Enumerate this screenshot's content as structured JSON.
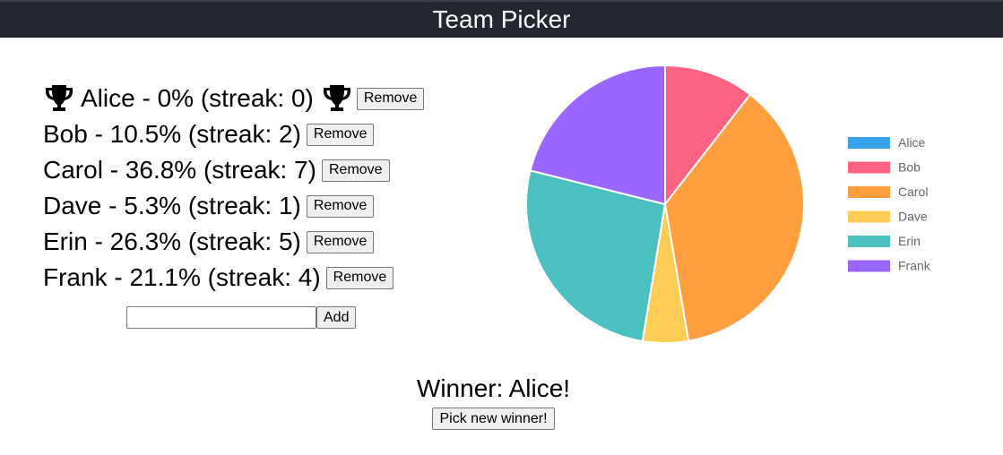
{
  "header": {
    "title": "Team Picker"
  },
  "players": [
    {
      "name": "Alice",
      "text": "Alice - 0% (streak: 0)",
      "percent": 0,
      "streak": 0,
      "winner": true,
      "remove_label": "Remove"
    },
    {
      "name": "Bob",
      "text": "Bob - 10.5% (streak: 2)",
      "percent": 10.5,
      "streak": 2,
      "winner": false,
      "remove_label": "Remove"
    },
    {
      "name": "Carol",
      "text": "Carol - 36.8% (streak: 7)",
      "percent": 36.8,
      "streak": 7,
      "winner": false,
      "remove_label": "Remove"
    },
    {
      "name": "Dave",
      "text": "Dave - 5.3% (streak: 1)",
      "percent": 5.3,
      "streak": 1,
      "winner": false,
      "remove_label": "Remove"
    },
    {
      "name": "Erin",
      "text": "Erin - 26.3% (streak: 5)",
      "percent": 26.3,
      "streak": 5,
      "winner": false,
      "remove_label": "Remove"
    },
    {
      "name": "Frank",
      "text": "Frank - 21.1% (streak: 4)",
      "percent": 21.1,
      "streak": 4,
      "winner": false,
      "remove_label": "Remove"
    }
  ],
  "add_form": {
    "input_value": "",
    "placeholder": "",
    "button_label": "Add"
  },
  "icons": {
    "winner_marker": "trophy-icon"
  },
  "chart_data": {
    "type": "pie",
    "legend_position": "right",
    "categories": [
      "Alice",
      "Bob",
      "Carol",
      "Dave",
      "Erin",
      "Frank"
    ],
    "values": [
      0,
      10.5,
      36.8,
      5.3,
      26.3,
      21.1
    ],
    "colors": [
      "#36a2eb",
      "#ff6384",
      "#ff9f40",
      "#ffcd56",
      "#4bc0c0",
      "#9966ff"
    ]
  },
  "winner": {
    "text": "Winner: Alice!"
  },
  "pick_button": {
    "label": "Pick new winner!"
  }
}
